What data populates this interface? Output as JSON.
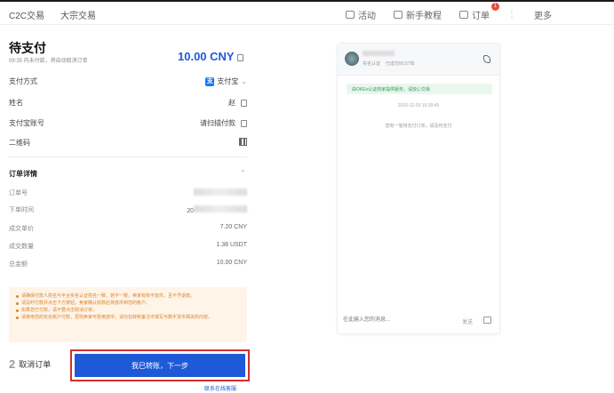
{
  "topnav": {
    "left": [
      "C2C交易",
      "大宗交易"
    ],
    "activity": "活动",
    "tutorial": "新手教程",
    "orders": "订单",
    "orders_badge": "1",
    "more": "更多"
  },
  "order": {
    "title": "待支付",
    "subtitle": "09:35 内未付款，将自动取消订单",
    "amount": "10.00 CNY",
    "payment_method_label": "支付方式",
    "payment_method_value": "支付宝",
    "name_label": "姓名",
    "name_value": "赵",
    "account_label": "支付宝账号",
    "account_value": "请扫描付款",
    "qrcode_label": "二维码"
  },
  "details": {
    "title": "订单详情",
    "order_no_label": "订单号",
    "time_label": "下单时间",
    "time_value_prefix": "20",
    "price_label": "成交单价",
    "price_value": "7.20 CNY",
    "quantity_label": "成交数量",
    "quantity_value": "1.38 USDT",
    "total_label": "总金额",
    "total_value": "10.00 CNY"
  },
  "notices": [
    "请确保付款人姓名与平台实名认证姓名一致，若不一致，卖家有权不放币，且不予退款。",
    "请及时付款并点击下方按钮，卖家确认收款后将放币到您的账户。",
    "如果您已付款，请不要点击取消订单。",
    "请使用您的实名账户付款，否则卖家可拒绝放币；请勿在转账备注中填写与数字货币相关的内容。"
  ],
  "actions": {
    "cancel_step": "2",
    "cancel": "取消订单",
    "confirm": "我已转账，下一步",
    "contact": "联系在线客服"
  },
  "chat": {
    "verified": "实名认证",
    "trades": "已成交80.57单",
    "safe_tip": "由OKEx认证商家提供服务，请放心交易",
    "time": "2020-12-03 10:39:49",
    "system_msg": "您有一笔待支付订单，请及时支付",
    "input_placeholder": "在此输入您的消息...",
    "send": "发送"
  },
  "colors": {
    "accent": "#1e5ad8",
    "highlight_border": "#d32f2f",
    "notice_bg": "#fff4e8",
    "notice_text": "#d9822b",
    "safe_bg": "#e9f7ee",
    "safe_text": "#2f9d57"
  }
}
